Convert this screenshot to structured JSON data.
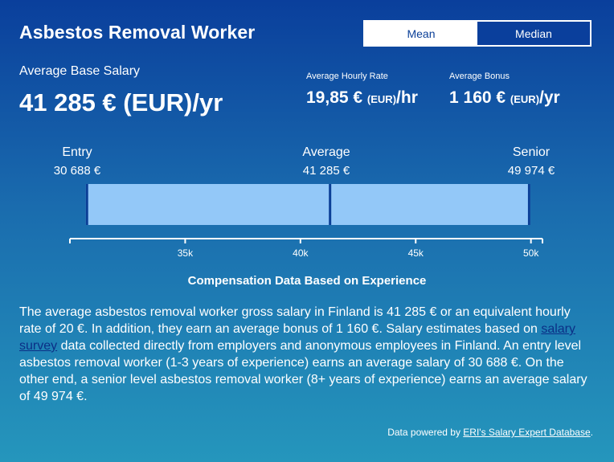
{
  "header": {
    "title": "Asbestos Removal Worker",
    "toggle": {
      "mean_label": "Mean",
      "median_label": "Median",
      "selected": "Mean"
    }
  },
  "salary": {
    "base_label": "Average Base Salary",
    "base_value": "41 285 € (EUR)/yr",
    "hourly_label": "Average Hourly Rate",
    "hourly_value": "19,85 €",
    "hourly_unit": "(EUR)",
    "hourly_suffix": "/hr",
    "bonus_label": "Average Bonus",
    "bonus_value": "1 160 €",
    "bonus_unit": "(EUR)",
    "bonus_suffix": "/yr"
  },
  "levels": {
    "entry_label": "Entry",
    "entry_value": "30 688 €",
    "average_label": "Average",
    "average_value": "41 285 €",
    "senior_label": "Senior",
    "senior_value": "49 974 €"
  },
  "chart_data": {
    "type": "bar",
    "range": {
      "min": 30688,
      "avg": 41285,
      "max": 49974
    },
    "axis_min": 30000,
    "axis_max": 50500,
    "ticks": [
      {
        "value": 35000,
        "label": "35k"
      },
      {
        "value": 40000,
        "label": "40k"
      },
      {
        "value": 45000,
        "label": "45k"
      },
      {
        "value": 50000,
        "label": "50k"
      }
    ],
    "bar_color": "#93c8f8",
    "edge_color": "#0b3f97"
  },
  "caption": "Compensation Data Based on Experience",
  "description": {
    "part1": "The average asbestos removal worker gross salary in Finland is 41 285 € or an equivalent hourly rate of 20 €. In addition, they earn an average bonus of 1 160 €. Salary estimates based on ",
    "link_text": "salary survey",
    "part2": " data collected directly from employers and anonymous employees in Finland. An entry level asbestos removal worker (1-3 years of experience) earns an average salary of 30 688 €. On the other end, a senior level asbestos removal worker (8+ years of experience) earns an average salary of 49 974 €."
  },
  "footer": {
    "prefix": "Data powered by ",
    "link_text": "ERI's Salary Expert Database",
    "suffix": "."
  }
}
